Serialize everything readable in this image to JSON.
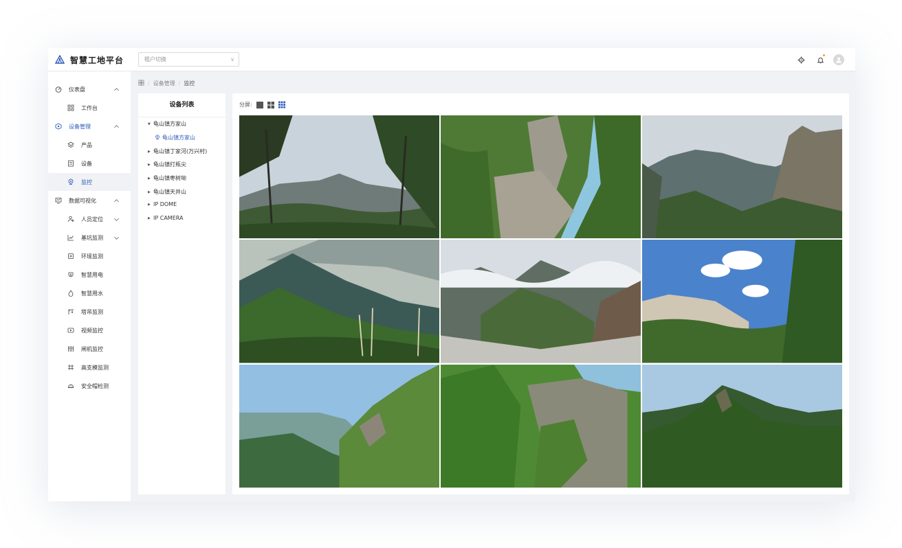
{
  "app": {
    "title": "智慧工地平台"
  },
  "tenant_select": {
    "placeholder": "租户切换"
  },
  "sidebar": {
    "items": [
      {
        "label": "仪表盘",
        "icon": "dashboard-icon",
        "arrow": "up"
      },
      {
        "label": "工作台",
        "icon": "grid-icon"
      },
      {
        "label": "设备管理",
        "icon": "device-icon",
        "arrow": "up",
        "highlight": true
      },
      {
        "label": "产品",
        "icon": "layers-icon"
      },
      {
        "label": "设备",
        "icon": "list-icon"
      },
      {
        "label": "监控",
        "icon": "camera-icon",
        "active": true
      },
      {
        "label": "数据可视化",
        "icon": "monitor-icon",
        "arrow": "up"
      },
      {
        "label": "人员定位",
        "icon": "person-icon",
        "arrow": "down"
      },
      {
        "label": "基坑监测",
        "icon": "chart-icon",
        "arrow": "down"
      },
      {
        "label": "环境监测",
        "icon": "env-icon"
      },
      {
        "label": "智慧用电",
        "icon": "power-icon"
      },
      {
        "label": "智慧用水",
        "icon": "water-icon"
      },
      {
        "label": "塔吊监测",
        "icon": "crane-icon"
      },
      {
        "label": "视频监控",
        "icon": "video-icon"
      },
      {
        "label": "闸机监控",
        "icon": "gate-icon"
      },
      {
        "label": "高支模监测",
        "icon": "formwork-icon"
      },
      {
        "label": "安全帽检测",
        "icon": "helmet-icon"
      }
    ]
  },
  "breadcrumb": {
    "level1": "设备管理",
    "level2": "监控"
  },
  "device_tree": {
    "title": "设备列表",
    "nodes": [
      {
        "label": "龟山镇方家山",
        "expanded": true
      },
      {
        "label": "龟山镇方家山",
        "leaf": true
      },
      {
        "label": "龟山镇丁家河(万兴村)"
      },
      {
        "label": "龟山镇打瓶尖"
      },
      {
        "label": "龟山镇枣树坳"
      },
      {
        "label": "龟山镇天井山"
      },
      {
        "label": "IP DOME"
      },
      {
        "label": "IP CAMERA"
      }
    ]
  },
  "split": {
    "label": "分屏:",
    "options": [
      "1x1",
      "2x2",
      "3x3"
    ],
    "selected": "3x3"
  },
  "cameras": [
    {
      "scene": "pine-trees-misty-mountain"
    },
    {
      "scene": "rock-cliff-green"
    },
    {
      "scene": "rocky-peaks-cloudy"
    },
    {
      "scene": "misty-ridges-grass"
    },
    {
      "scene": "clouds-rocky-valley"
    },
    {
      "scene": "granite-blue-sky"
    },
    {
      "scene": "valley-view-slope"
    },
    {
      "scene": "green-cliff"
    },
    {
      "scene": "green-peak"
    }
  ],
  "colors": {
    "accent": "#2d5cb8",
    "bell_dot": "#e6a23c"
  }
}
